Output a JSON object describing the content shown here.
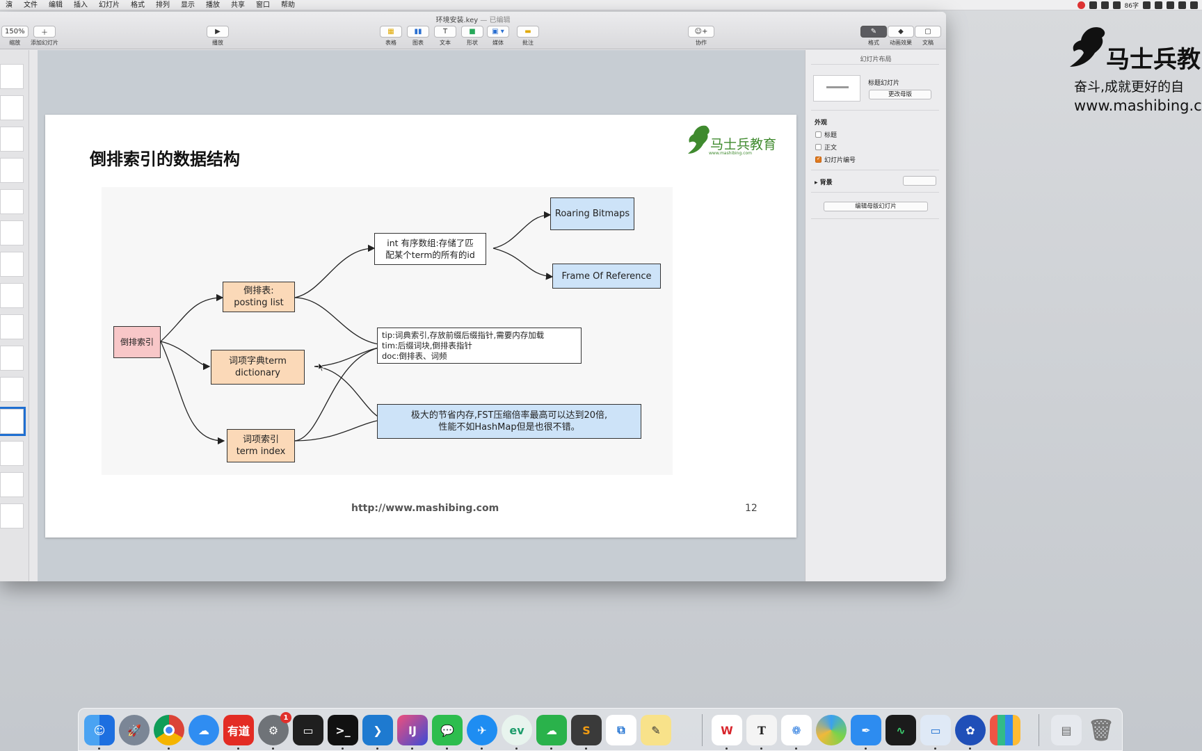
{
  "menubar": {
    "items": [
      "演",
      "文件",
      "编辑",
      "插入",
      "幻灯片",
      "格式",
      "排列",
      "显示",
      "播放",
      "共享",
      "窗口",
      "帮助"
    ],
    "status_text": "86字"
  },
  "window": {
    "title": "环境安装.key",
    "title_status": "— 已编辑"
  },
  "toolbar": {
    "zoom": "150%",
    "zoom_label": "缩放",
    "add_slide_label": "添加幻灯片",
    "play_label": "播放",
    "table_label": "表格",
    "chart_label": "图表",
    "text_label": "文本",
    "shape_label": "形状",
    "media_label": "媒体",
    "comment_label": "批注",
    "collab_label": "协作",
    "format_label": "格式",
    "animate_label": "动画效果",
    "document_label": "文稿"
  },
  "inspector": {
    "header": "幻灯片布局",
    "layout_name": "标题幻灯片",
    "change_master_btn": "更改母版",
    "appearance_label": "外观",
    "checkboxes": [
      {
        "label": "标题",
        "checked": false
      },
      {
        "label": "正文",
        "checked": false
      },
      {
        "label": "幻灯片编号",
        "checked": true
      }
    ],
    "background_label": "背景",
    "edit_master_btn": "编辑母版幻灯片"
  },
  "slide": {
    "title": "倒排索引的数据结构",
    "logo_text": "马士兵教育",
    "logo_sub": "www.mashibing.com",
    "url": "http://www.mashibing.com",
    "number": "12",
    "nodes": {
      "root": "倒排索引",
      "posting_line1": "倒排表:",
      "posting_line2": "posting list",
      "dict_line1": "词项字典term",
      "dict_line2": "dictionary",
      "index_line1": "词项索引",
      "index_line2": "term index",
      "int_line1": "int 有序数组:存储了匹",
      "int_line2": "配某个term的所有的id",
      "roaring": "Roaring Bitmaps",
      "for": "Frame Of Reference",
      "tip_line1": "tip:词典索引,存放前缀后缀指针,需要内存加载",
      "tip_line2": "tim:后缀词块,倒排表指针",
      "tip_line3": "doc:倒排表、词频",
      "fst_line1": "极大的节省内存,FST压缩倍率最高可以达到20倍,",
      "fst_line2": "性能不如HashMap但是也很不错。"
    }
  },
  "watermark": {
    "title": "马士兵教",
    "slogan": "奋斗,成就更好的自",
    "url": "www.mashibing.c"
  },
  "dock": {
    "youdao_text": "有道",
    "terminal_text": ">_",
    "settings_badge": "1",
    "typora_text": "T",
    "apps": [
      "finder",
      "launchpad",
      "chrome",
      "cloud-drive",
      "youdao",
      "system-preferences",
      "zen-terminal",
      "terminal",
      "vscode",
      "intellij",
      "wechat",
      "feishu",
      "edge-like",
      "network-tool",
      "sublime",
      "vmware",
      "stickies",
      "wps",
      "typora",
      "baidu-netdisk",
      "colorful-app",
      "pen-app",
      "activity-monitor",
      "keynote",
      "davinci",
      "books",
      "preview-folder",
      "trash"
    ]
  },
  "colors": {
    "node_pink": "#f8c7c8",
    "node_orange": "#fbd9b8",
    "node_blue": "#cde3f8",
    "selection_blue": "#1f6fd1",
    "logo_green": "#3f8a2e"
  }
}
